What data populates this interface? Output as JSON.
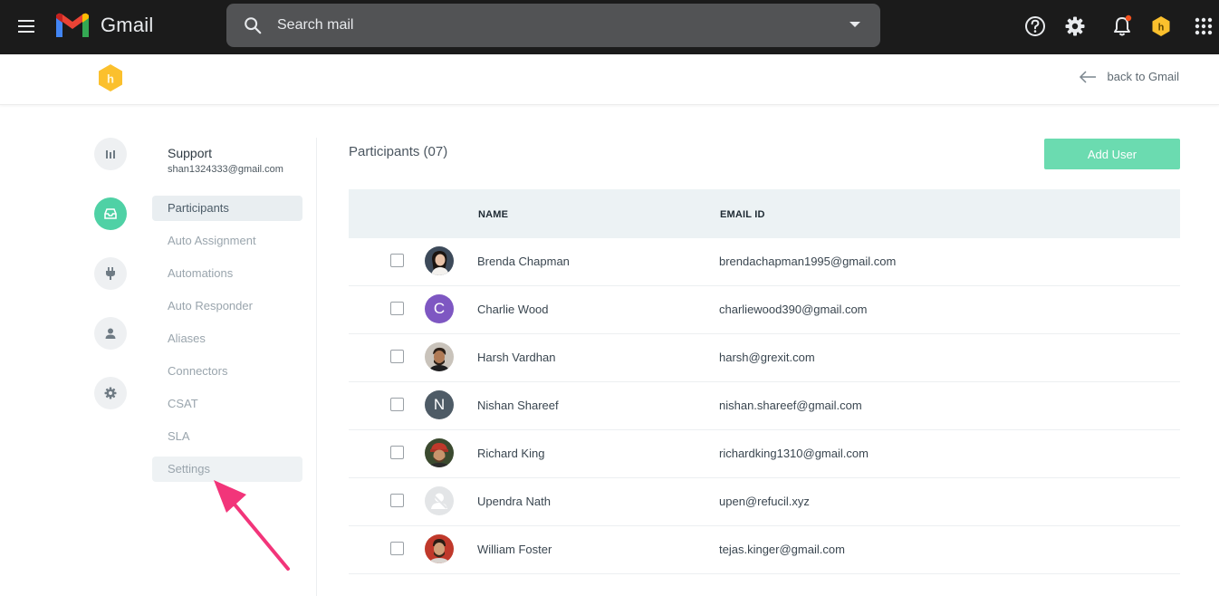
{
  "topbar": {
    "app_name": "Gmail",
    "search": {
      "placeholder": "Search mail"
    },
    "icons": [
      "menu-icon",
      "help-icon",
      "gear-icon",
      "bell-icon",
      "grexit-icon",
      "apps-grid-icon"
    ],
    "notification_dot_color": "#f4511e"
  },
  "header": {
    "back_label": "back to Gmail",
    "brand_color": "#fbc02d"
  },
  "rail": {
    "items": [
      {
        "icon": "bar-chart-icon",
        "active": false
      },
      {
        "icon": "inbox-icon",
        "active": true
      },
      {
        "icon": "plug-icon",
        "active": false
      },
      {
        "icon": "person-icon",
        "active": false
      },
      {
        "icon": "gear-icon",
        "active": false
      }
    ],
    "active_color": "#4fd1a5"
  },
  "sidebar": {
    "workspace": "Support",
    "email": "shan1324333@gmail.com",
    "items": [
      {
        "label": "Participants",
        "active": true
      },
      {
        "label": "Auto Assignment",
        "active": false
      },
      {
        "label": "Automations",
        "active": false
      },
      {
        "label": "Auto Responder",
        "active": false
      },
      {
        "label": "Aliases",
        "active": false
      },
      {
        "label": "Connectors",
        "active": false
      },
      {
        "label": "CSAT",
        "active": false
      },
      {
        "label": "SLA",
        "active": false
      },
      {
        "label": "Settings",
        "active": false
      }
    ]
  },
  "main": {
    "title": "Participants (07)",
    "add_user_label": "Add User",
    "accent_color": "#6bdbb0",
    "columns": {
      "name": "NAME",
      "email": "EMAIL ID"
    },
    "participants": [
      {
        "name": "Brenda Chapman",
        "email": "brendachapman1995@gmail.com",
        "avatar": "photo"
      },
      {
        "name": "Charlie Wood",
        "email": "charliewood390@gmail.com",
        "avatar": "C",
        "avatar_color": "#7e57c2"
      },
      {
        "name": "Harsh Vardhan",
        "email": "harsh@grexit.com",
        "avatar": "photo"
      },
      {
        "name": "Nishan Shareef",
        "email": "nishan.shareef@gmail.com",
        "avatar": "N",
        "avatar_color": "#4e5b66"
      },
      {
        "name": "Richard King",
        "email": "richardking1310@gmail.com",
        "avatar": "photo"
      },
      {
        "name": "Upendra Nath",
        "email": "upen@refucil.xyz",
        "avatar": "placeholder"
      },
      {
        "name": "William Foster",
        "email": "tejas.kinger@gmail.com",
        "avatar": "photo"
      }
    ]
  },
  "annotation": {
    "type": "arrow",
    "color": "#f2357a",
    "points_to": "Settings"
  }
}
